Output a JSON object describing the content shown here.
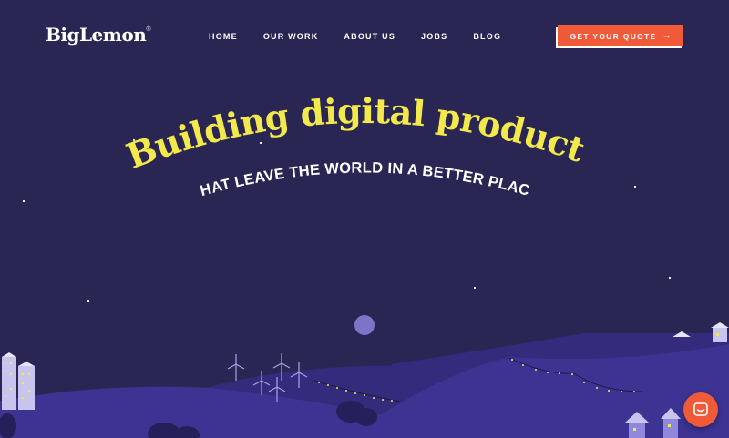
{
  "header": {
    "logo": "BigLemon",
    "logo_mark": "®",
    "nav": [
      {
        "label": "HOME"
      },
      {
        "label": "OUR WORK"
      },
      {
        "label": "ABOUT US"
      },
      {
        "label": "JOBS"
      },
      {
        "label": "BLOG"
      }
    ],
    "cta": {
      "label": "GET YOUR QUOTE",
      "icon": "arrow-right-icon"
    }
  },
  "hero": {
    "headline": "Building digital products",
    "subheadline": "THAT LEAVE THE WORLD IN A BETTER PLACE"
  },
  "chat": {
    "icon": "chat-bubble-icon"
  },
  "colors": {
    "background": "#2a2654",
    "headline": "#f4e94a",
    "accent": "#f05a39",
    "hill_near": "#3c3392",
    "hill_far": "#332c7c",
    "moon": "#7d74c8"
  }
}
